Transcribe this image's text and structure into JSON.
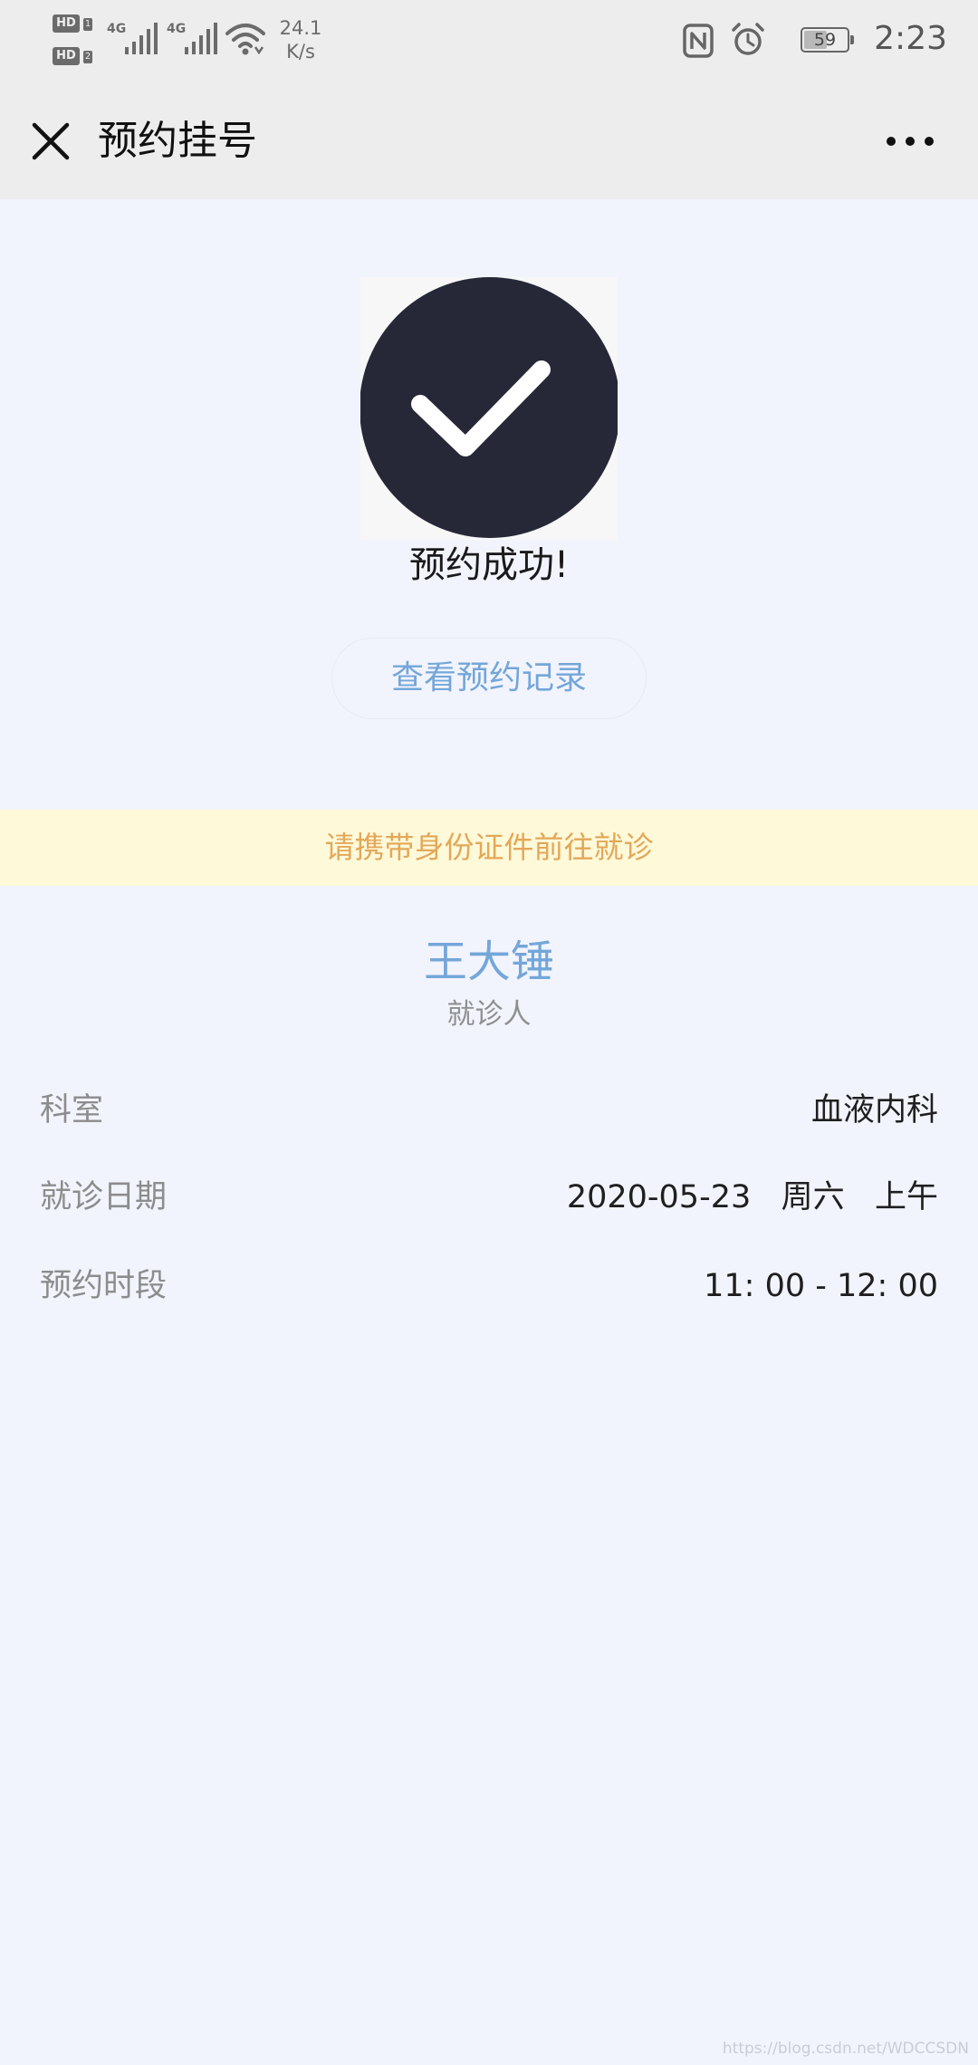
{
  "status_bar": {
    "hd_1": "HD",
    "hd_1_index": "1",
    "hd_2": "HD",
    "hd_2_index": "2",
    "network_1": "4G",
    "network_2": "4G",
    "speed_value": "24.1",
    "speed_unit": "K/s",
    "battery_level": "59",
    "time": "2:23",
    "icons": [
      "signal-bars-icon",
      "wifi-icon",
      "nfc-icon",
      "alarm-icon",
      "battery-icon"
    ]
  },
  "nav": {
    "title": "预约挂号",
    "close_icon": "close-icon",
    "more_icon": "more-icon"
  },
  "success": {
    "icon": "check-circle-icon",
    "title": "预约成功!",
    "record_button": "查看预约记录"
  },
  "notice": {
    "text": "请携带身份证件前往就诊"
  },
  "patient": {
    "name": "王大锤",
    "label": "就诊人"
  },
  "details": [
    {
      "label": "科室",
      "value": "血液内科"
    },
    {
      "label": "就诊日期",
      "value": "2020-05-23   周六   上午"
    },
    {
      "label": "预约时段",
      "value": "11: 00 - 12: 00"
    }
  ],
  "watermark": "https://blog.csdn.net/WDCCSDN",
  "colors": {
    "background": "#f2f4fd",
    "bar_background": "#ededed",
    "accent_blue": "#74a6d9",
    "notice_background": "#fef9d9",
    "notice_text": "#e3a859",
    "check_circle": "#262838"
  }
}
